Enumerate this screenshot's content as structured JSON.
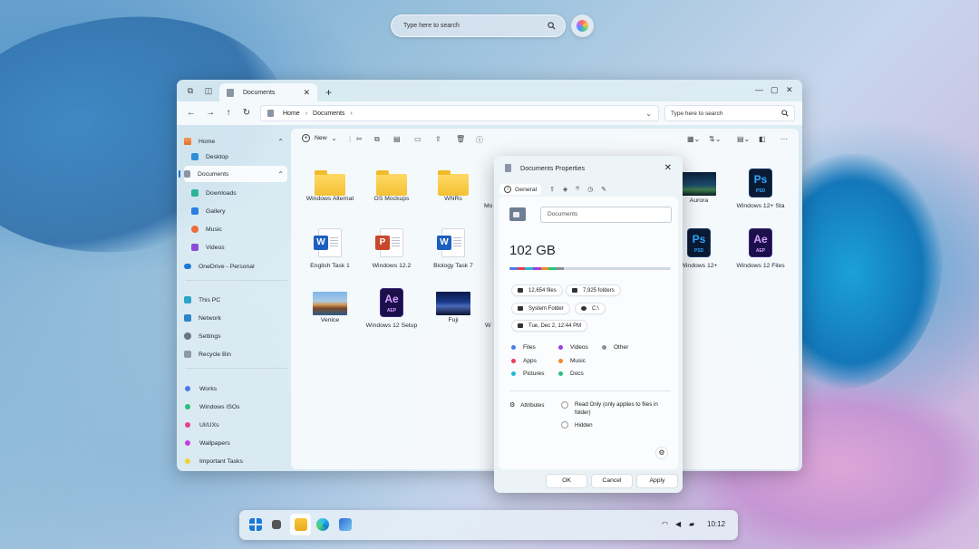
{
  "top_search": {
    "placeholder": "Type here to search"
  },
  "window": {
    "tab_title": "Documents",
    "address": {
      "root": "Home",
      "folder": "Documents"
    },
    "search_placeholder": "Type here to search",
    "new_label": "New"
  },
  "sidebar": {
    "home": "Home",
    "desktop": "Desktop",
    "documents": "Documents",
    "downloads": "Downloads",
    "gallery": "Gallery",
    "music": "Music",
    "videos": "Videos",
    "onedrive": "OneDrive - Personal",
    "thispc": "This PC",
    "network": "Network",
    "settings": "Settings",
    "recycle": "Recycle Bin",
    "tags": [
      {
        "label": "Works",
        "color": "#4c7be8"
      },
      {
        "label": "Windows ISOs",
        "color": "#2bc07a"
      },
      {
        "label": "UI/UXs",
        "color": "#e8408f"
      },
      {
        "label": "Wallpapers",
        "color": "#c53fe0"
      },
      {
        "label": "Important Tasks",
        "color": "#f0d43a"
      }
    ]
  },
  "files": [
    {
      "name": "Windows Alternat",
      "type": "folder"
    },
    {
      "name": "OS Mockups",
      "type": "folder"
    },
    {
      "name": "WNRs",
      "type": "folder"
    },
    {
      "name": "Mo",
      "type": "folder"
    },
    {
      "name": "Aurora",
      "type": "photo-aurora"
    },
    {
      "name": "Windows 12+ Sta",
      "type": "ps"
    },
    {
      "name": "English Task 1",
      "type": "word"
    },
    {
      "name": "Windows 12.2",
      "type": "ppt"
    },
    {
      "name": "Biology Task 7",
      "type": "word"
    },
    {
      "name": "Windows 12+",
      "type": "ps"
    },
    {
      "name": "Windows 12 Files",
      "type": "ae"
    },
    {
      "name": "Venice",
      "type": "photo-venice"
    },
    {
      "name": "Windows 12 Setup",
      "type": "ae"
    },
    {
      "name": "Fuji",
      "type": "photo-fuji"
    },
    {
      "name": "W",
      "type": "partial"
    }
  ],
  "icons": {
    "word": "W",
    "ppt": "P",
    "ps": "Ps",
    "ae": "Ae",
    "psd": "PSD",
    "aep": "AEP"
  },
  "properties": {
    "title": "Documents Properties",
    "general_tab": "General",
    "name_value": "Documents",
    "size": "102 GB",
    "files_count": "12,654 files",
    "folders_count": "7,925 folders",
    "folder_type": "System Folder",
    "path": "C:\\",
    "modified": "Tue, Dec 2, 12:44 PM",
    "legend": [
      {
        "label": "Files",
        "color": "#4c7be8"
      },
      {
        "label": "Videos",
        "color": "#9b3fe0"
      },
      {
        "label": "Other",
        "color": "#8a8f96"
      },
      {
        "label": "Apps",
        "color": "#e83b5a"
      },
      {
        "label": "Music",
        "color": "#f08a2a"
      },
      {
        "label": "Pictures",
        "color": "#27b8d8"
      },
      {
        "label": "Docs",
        "color": "#2bc07a"
      }
    ],
    "attributes_label": "Attributes",
    "read_only": "Read Only (only applies to files in folder)",
    "hidden": "Hidden",
    "ok": "OK",
    "cancel": "Cancel",
    "apply": "Apply"
  },
  "taskbar": {
    "time": "10:12"
  }
}
